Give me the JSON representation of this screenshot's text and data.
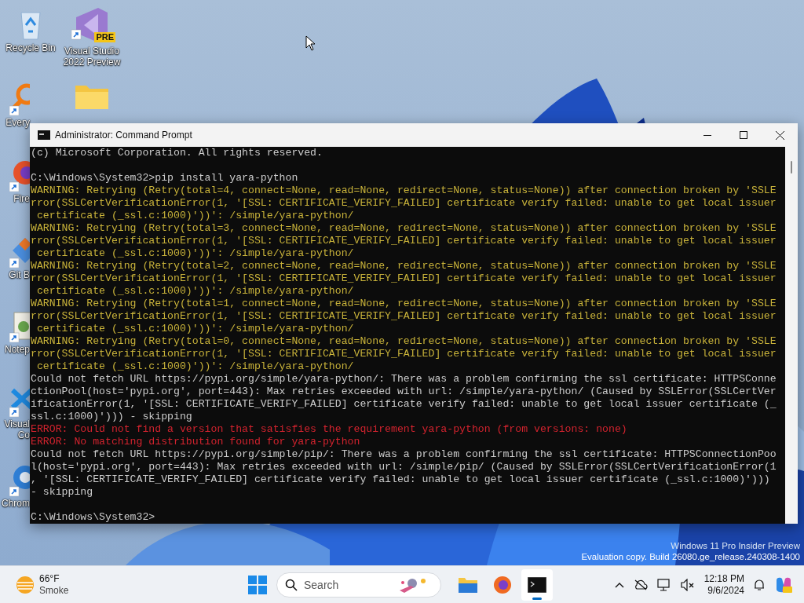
{
  "desktop": {
    "icons": [
      {
        "kind": "recycle",
        "lines": [
          "Recycle Bin"
        ]
      },
      {
        "kind": "visualstudio",
        "lines": [
          "Visual Studio",
          "2022 Preview"
        ],
        "badge": "PRE"
      },
      {
        "kind": "everything",
        "lines": [
          "Every"
        ]
      },
      {
        "kind": "folder"
      },
      {
        "kind": "firefox",
        "lines": [
          "Fire"
        ]
      },
      {
        "kind": "git",
        "lines": [
          "Git B"
        ]
      },
      {
        "kind": "notepad",
        "lines": [
          "Notep"
        ]
      },
      {
        "kind": "vscode",
        "lines": [
          "Visual",
          "Co"
        ]
      },
      {
        "kind": "chrome",
        "lines": [
          "Chrom"
        ]
      }
    ]
  },
  "window": {
    "title": "Administrator: Command Prompt",
    "lines": [
      {
        "kind": "normal",
        "text": "(c) Microsoft Corporation. All rights reserved."
      },
      {
        "kind": "blank"
      },
      {
        "kind": "normal",
        "text": "C:\\Windows\\System32>pip install yara-python"
      },
      {
        "kind": "warning",
        "text": "WARNING: Retrying (Retry(total=4, connect=None, read=None, redirect=None, status=None)) after connection broken by 'SSLE"
      },
      {
        "kind": "warning",
        "text": "rror(SSLCertVerificationError(1, '[SSL: CERTIFICATE_VERIFY_FAILED] certificate verify failed: unable to get local issuer"
      },
      {
        "kind": "warning",
        "text": " certificate (_ssl.c:1000)'))': /simple/yara-python/"
      },
      {
        "kind": "warning",
        "text": "WARNING: Retrying (Retry(total=3, connect=None, read=None, redirect=None, status=None)) after connection broken by 'SSLE"
      },
      {
        "kind": "warning",
        "text": "rror(SSLCertVerificationError(1, '[SSL: CERTIFICATE_VERIFY_FAILED] certificate verify failed: unable to get local issuer"
      },
      {
        "kind": "warning",
        "text": " certificate (_ssl.c:1000)'))': /simple/yara-python/"
      },
      {
        "kind": "warning",
        "text": "WARNING: Retrying (Retry(total=2, connect=None, read=None, redirect=None, status=None)) after connection broken by 'SSLE"
      },
      {
        "kind": "warning",
        "text": "rror(SSLCertVerificationError(1, '[SSL: CERTIFICATE_VERIFY_FAILED] certificate verify failed: unable to get local issuer"
      },
      {
        "kind": "warning",
        "text": " certificate (_ssl.c:1000)'))': /simple/yara-python/"
      },
      {
        "kind": "warning",
        "text": "WARNING: Retrying (Retry(total=1, connect=None, read=None, redirect=None, status=None)) after connection broken by 'SSLE"
      },
      {
        "kind": "warning",
        "text": "rror(SSLCertVerificationError(1, '[SSL: CERTIFICATE_VERIFY_FAILED] certificate verify failed: unable to get local issuer"
      },
      {
        "kind": "warning",
        "text": " certificate (_ssl.c:1000)'))': /simple/yara-python/"
      },
      {
        "kind": "warning",
        "text": "WARNING: Retrying (Retry(total=0, connect=None, read=None, redirect=None, status=None)) after connection broken by 'SSLE"
      },
      {
        "kind": "warning",
        "text": "rror(SSLCertVerificationError(1, '[SSL: CERTIFICATE_VERIFY_FAILED] certificate verify failed: unable to get local issuer"
      },
      {
        "kind": "warning",
        "text": " certificate (_ssl.c:1000)'))': /simple/yara-python/"
      },
      {
        "kind": "normal",
        "text": "Could not fetch URL https://pypi.org/simple/yara-python/: There was a problem confirming the ssl certificate: HTTPSConne"
      },
      {
        "kind": "normal",
        "text": "ctionPool(host='pypi.org', port=443): Max retries exceeded with url: /simple/yara-python/ (Caused by SSLError(SSLCertVer"
      },
      {
        "kind": "normal",
        "text": "ificationError(1, '[SSL: CERTIFICATE_VERIFY_FAILED] certificate verify failed: unable to get local issuer certificate (_"
      },
      {
        "kind": "normal",
        "text": "ssl.c:1000)'))) - skipping"
      },
      {
        "kind": "error",
        "text": "ERROR: Could not find a version that satisfies the requirement yara-python (from versions: none)"
      },
      {
        "kind": "error",
        "text": "ERROR: No matching distribution found for yara-python"
      },
      {
        "kind": "normal",
        "text": "Could not fetch URL https://pypi.org/simple/pip/: There was a problem confirming the ssl certificate: HTTPSConnectionPoo"
      },
      {
        "kind": "normal",
        "text": "l(host='pypi.org', port=443): Max retries exceeded with url: /simple/pip/ (Caused by SSLError(SSLCertVerificationError(1"
      },
      {
        "kind": "normal",
        "text": ", '[SSL: CERTIFICATE_VERIFY_FAILED] certificate verify failed: unable to get local issuer certificate (_ssl.c:1000)')))"
      },
      {
        "kind": "normal",
        "text": "- skipping"
      },
      {
        "kind": "blank"
      },
      {
        "kind": "normal",
        "text": "C:\\Windows\\System32>"
      }
    ]
  },
  "watermark": {
    "lines": [
      "Windows 11 Pro Insider Preview",
      "Evaluation copy. Build 26080.ge_release.240308-1400"
    ]
  },
  "taskbar": {
    "weather": {
      "temperature": "66°F",
      "condition": "Smoke"
    },
    "search": {
      "placeholder": "Search"
    },
    "apps": [
      {
        "kind": "explorer",
        "active": false
      },
      {
        "kind": "firefox",
        "active": false
      },
      {
        "kind": "terminal",
        "active": true
      }
    ],
    "clock": {
      "time": "12:18 PM",
      "date": "9/6/2024"
    }
  }
}
